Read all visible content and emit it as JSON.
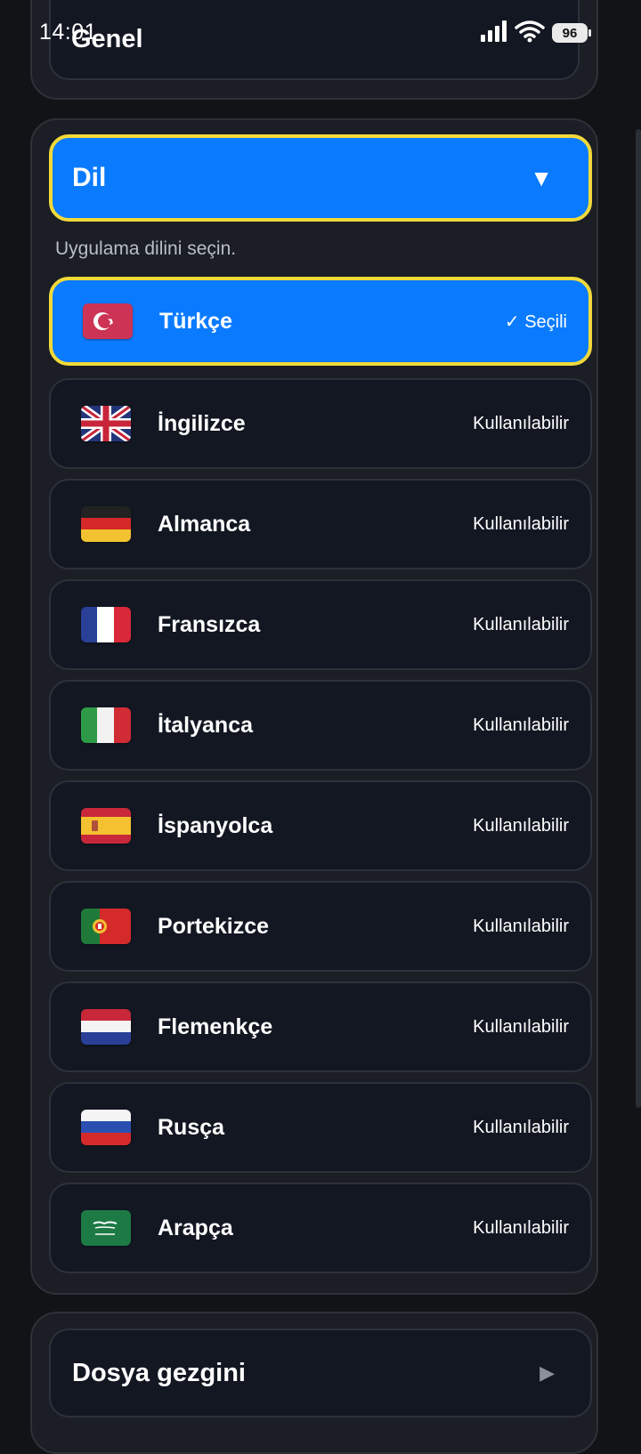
{
  "status": {
    "time": "14:01",
    "battery": "96"
  },
  "general": {
    "title": "Genel"
  },
  "language_section": {
    "header": "Dil",
    "arrow": "▼",
    "subtitle": "Uygulama dilini seçin.",
    "items": [
      {
        "name": "Türkçe",
        "status": "✓ Seçili",
        "flag": "tr-flag",
        "selected": true
      },
      {
        "name": "İngilizce",
        "status": "Kullanılabilir",
        "flag": "gb-flag",
        "selected": false
      },
      {
        "name": "Almanca",
        "status": "Kullanılabilir",
        "flag": "de-flag",
        "selected": false
      },
      {
        "name": "Fransızca",
        "status": "Kullanılabilir",
        "flag": "fr-flag",
        "selected": false
      },
      {
        "name": "İtalyanca",
        "status": "Kullanılabilir",
        "flag": "it-flag",
        "selected": false
      },
      {
        "name": "İspanyolca",
        "status": "Kullanılabilir",
        "flag": "es-flag",
        "selected": false
      },
      {
        "name": "Portekizce",
        "status": "Kullanılabilir",
        "flag": "pt-flag",
        "selected": false
      },
      {
        "name": "Flemenkçe",
        "status": "Kullanılabilir",
        "flag": "nl-flag",
        "selected": false
      },
      {
        "name": "Rusça",
        "status": "Kullanılabilir",
        "flag": "ru-flag",
        "selected": false
      },
      {
        "name": "Arapça",
        "status": "Kullanılabilir",
        "flag": "sa-flag",
        "selected": false
      }
    ]
  },
  "file_explorer": {
    "label": "Dosya gezgini",
    "arrow": "▶"
  },
  "colors": {
    "accent": "#0a7bff",
    "highlight_border": "#f1d93a",
    "background": "#111316"
  }
}
